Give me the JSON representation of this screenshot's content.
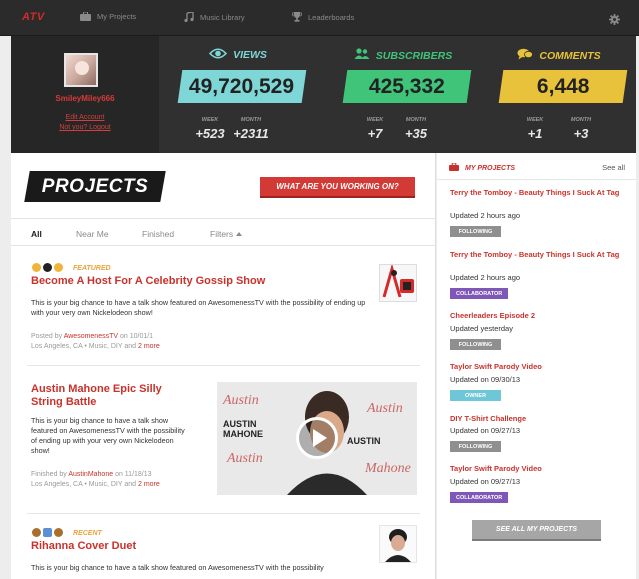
{
  "app": {
    "logo": "ATV"
  },
  "nav": [
    {
      "label": "My Projects",
      "icon": "briefcase-icon"
    },
    {
      "label": "Music Library",
      "icon": "music-note-icon"
    },
    {
      "label": "Leaderboards",
      "icon": "trophy-icon"
    }
  ],
  "profile": {
    "username": "SmileyMiley666",
    "edit_account": "Edit Account",
    "logout": "Not you? Logout"
  },
  "stats": {
    "views": {
      "label": "VIEWS",
      "value": "49,720,529",
      "week_label": "WEEK",
      "week": "+523",
      "month_label": "MONTH",
      "month": "+2311",
      "color": "#7fd6d6"
    },
    "subscribers": {
      "label": "SUBSCRIBERS",
      "value": "425,332",
      "week_label": "WEEK",
      "week": "+7",
      "month_label": "MONTH",
      "month": "+35",
      "color": "#3fc47a"
    },
    "comments": {
      "label": "COMMENTS",
      "value": "6,448",
      "week_label": "WEEK",
      "week": "+1",
      "month_label": "MONTH",
      "month": "+3",
      "color": "#e8c23a"
    }
  },
  "main": {
    "title": "PROJECTS",
    "cta": "WHAT ARE YOU WORKING ON?",
    "tabs": [
      "All",
      "Near Me",
      "Finished",
      "Filters"
    ],
    "projects": [
      {
        "tag": "FEATURED",
        "title": "Become A Host For A Celebrity Gossip Show",
        "desc": "This is your big chance to have a talk show featured on AwesomenessTV with the possibility of ending up with your very own Nickelodeon show!",
        "meta1_prefix": "Posted by ",
        "meta1_user": "AwesomenessTV",
        "meta1_suffix": " on 10/01/1",
        "meta2": "Los Angeles, CA • Music, DIY and ",
        "meta2_more": "2 more"
      },
      {
        "title": "Austin Mahone Epic Silly String Battle",
        "desc": "This is your big chance to have a talk show featured on AwesomenessTV with the possibility of ending up with your very own Nickelodeon show!",
        "meta1_prefix": "Finished by ",
        "meta1_user": "AustinMahone",
        "meta1_suffix": " on 11/18/13",
        "meta2": "Los Angeles, CA • Music, DIY and ",
        "meta2_more": "2 more"
      },
      {
        "tag": "RECENT",
        "title": "Rihanna Cover Duet",
        "desc": "This is your big chance to have a talk show featured on AwesomenessTV with the possibility"
      }
    ]
  },
  "sidebar": {
    "title": "MY PROJECTS",
    "see_all": "See all",
    "items": [
      {
        "title": "Terry the Tomboy - Beauty Things I Suck At Tag",
        "updated": "Updated 2 hours ago",
        "badge": "FOLLOWING",
        "badge_color": "#8f8f8f"
      },
      {
        "title": "Terry the Tomboy - Beauty Things I Suck At Tag",
        "updated": "Updated 2 hours ago",
        "badge": "COLLABORATOR",
        "badge_color": "#7e57b8"
      },
      {
        "title": "Cheerleaders Episode 2",
        "updated": "Updated yesterday",
        "badge": "FOLLOWING",
        "badge_color": "#8f8f8f"
      },
      {
        "title": "Taylor Swift Parody Video",
        "updated": "Updated on 09/30/13",
        "badge": "OWNER",
        "badge_color": "#6ec6d6"
      },
      {
        "title": "DIY T-Shirt Challenge",
        "updated": "Updated on 09/27/13",
        "badge": "FOLLOWING",
        "badge_color": "#8f8f8f"
      },
      {
        "title": "Taylor Swift Parody Video",
        "updated": "Updated on 09/27/13",
        "badge": "COLLABORATOR",
        "badge_color": "#7e57b8"
      }
    ],
    "see_all_button": "SEE ALL MY PROJECTS"
  }
}
